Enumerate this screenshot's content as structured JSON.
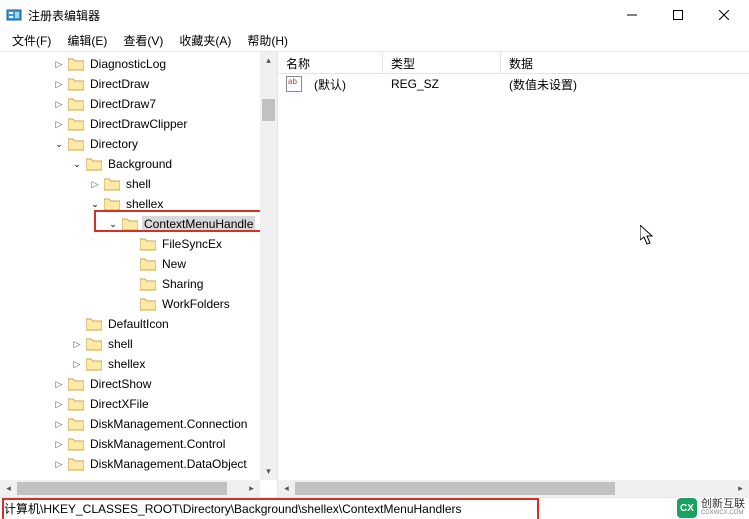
{
  "window": {
    "title": "注册表编辑器"
  },
  "menus": {
    "file": "文件(F)",
    "edit": "编辑(E)",
    "view": "查看(V)",
    "fav": "收藏夹(A)",
    "help": "帮助(H)"
  },
  "tree": {
    "n0": "DiagnosticLog",
    "n1": "DirectDraw",
    "n2": "DirectDraw7",
    "n3": "DirectDrawClipper",
    "n4": "Directory",
    "n5": "Background",
    "n6": "shell",
    "n7": "shellex",
    "n8": "ContextMenuHandle",
    "n9": "FileSyncEx",
    "n10": "New",
    "n11": "Sharing",
    "n12": "WorkFolders",
    "n13": "DefaultIcon",
    "n14": "shell",
    "n15": "shellex",
    "n16": "DirectShow",
    "n17": "DirectXFile",
    "n18": "DiskManagement.Connection",
    "n19": "DiskManagement.Control",
    "n20": "DiskManagement.DataObject"
  },
  "list": {
    "cols": {
      "name": "名称",
      "type": "类型",
      "data": "数据"
    },
    "row0": {
      "name": "(默认)",
      "type": "REG_SZ",
      "data": "(数值未设置)"
    }
  },
  "pathbar": "计算机\\HKEY_CLASSES_ROOT\\Directory\\Background\\shellex\\ContextMenuHandlers",
  "watermark": {
    "brand_cn": "创新互联",
    "brand_sub": "CDXWCX.COM"
  }
}
